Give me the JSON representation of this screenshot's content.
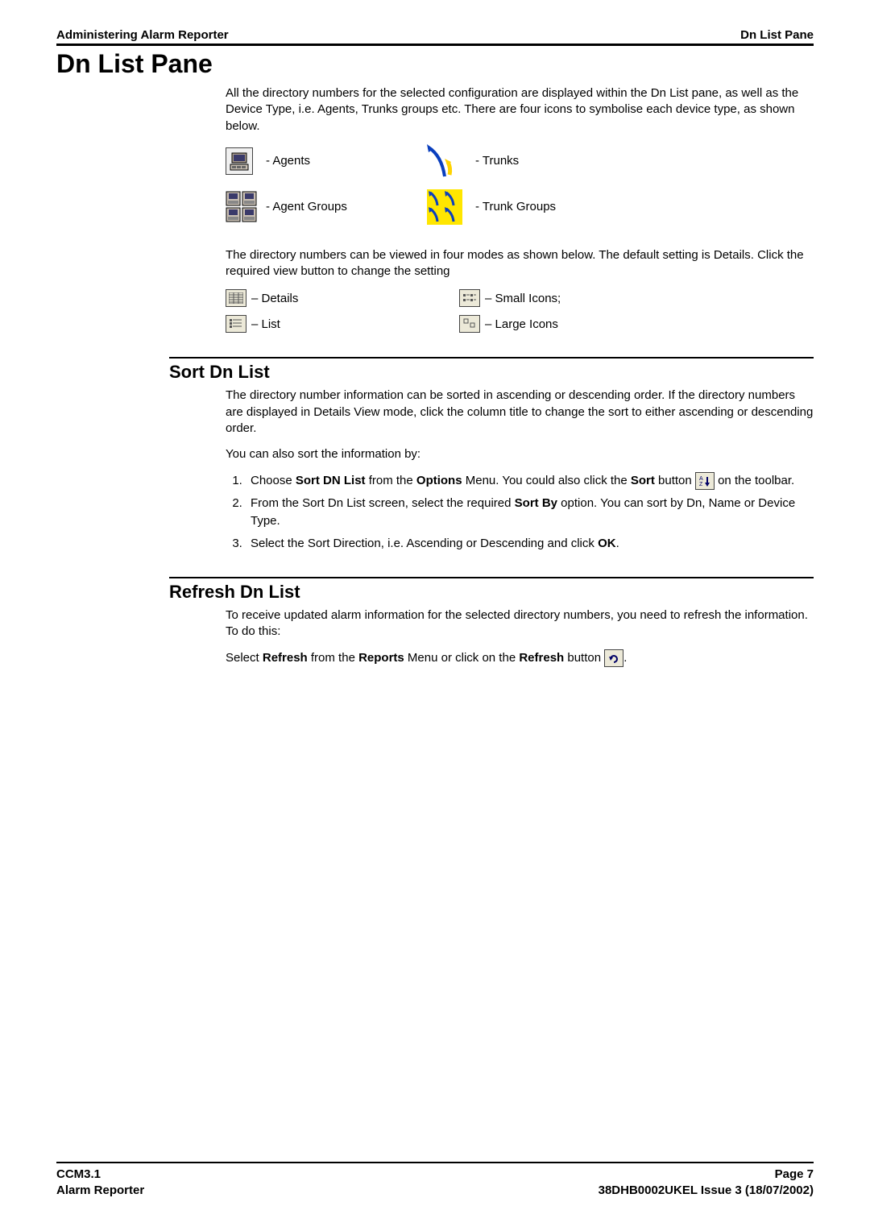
{
  "header": {
    "left": "Administering Alarm Reporter",
    "right": "Dn List Pane"
  },
  "title": "Dn List Pane",
  "intro_para": "All the directory numbers for the selected configuration are displayed within the Dn List pane, as well as the Device Type, i.e. Agents, Trunks groups etc.  There are four icons to symbolise each device type, as shown below.",
  "device_types": {
    "agents": "- Agents",
    "trunks": "- Trunks",
    "agent_groups": "- Agent Groups",
    "trunk_groups": "- Trunk Groups"
  },
  "view_modes_para": "The directory numbers can be viewed in four modes as shown below.  The default setting is Details.  Click the required view button to change the setting",
  "view_modes": {
    "details": " – Details",
    "small": " – Small Icons;",
    "list": " – List",
    "large": " – Large Icons"
  },
  "sort_section": {
    "heading": "Sort Dn List",
    "para1": "The directory number information can be sorted in ascending or descending order.  If the directory numbers are displayed in Details View mode, click the column title to change the sort to either ascending or descending order.",
    "para2": "You can also sort the information by:",
    "step1_pre": "Choose ",
    "step1_b1": "Sort DN List",
    "step1_mid1": " from the ",
    "step1_b2": "Options",
    "step1_mid2": " Menu.  You could also click the ",
    "step1_b3": "Sort",
    "step1_post": " button ",
    "step1_tail": " on the toolbar.",
    "step2_pre": "From the Sort Dn List screen, select the required ",
    "step2_b1": "Sort By",
    "step2_post": " option.  You can sort by Dn, Name or Device Type.",
    "step3_pre": "Select the Sort Direction, i.e. Ascending or Descending and click ",
    "step3_b1": "OK",
    "step3_post": "."
  },
  "refresh_section": {
    "heading": "Refresh Dn List",
    "para1": "To receive updated alarm information for the selected directory numbers, you need to refresh the information.  To do this:",
    "para2_pre": "Select ",
    "para2_b1": "Refresh",
    "para2_mid1": " from the ",
    "para2_b2": "Reports",
    "para2_mid2": " Menu or click on the ",
    "para2_b3": "Refresh",
    "para2_mid3": " button ",
    "para2_tail": "."
  },
  "footer": {
    "left_line1": "CCM3.1",
    "left_line2": "Alarm Reporter",
    "right_line1": "Page 7",
    "right_line2": "38DHB0002UKEL Issue 3 (18/07/2002)"
  }
}
